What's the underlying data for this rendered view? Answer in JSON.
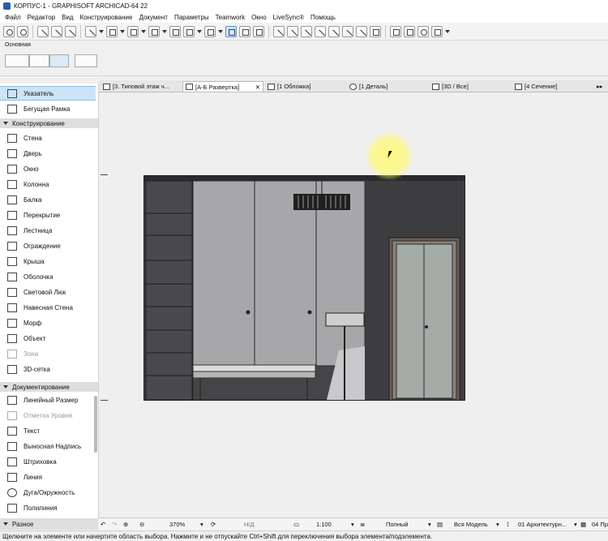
{
  "window": {
    "title": "КОРПУС-1 - GRAPHISOFT ARCHICAD-64 22"
  },
  "menu": [
    "Файл",
    "Редактор",
    "Вид",
    "Конструирование",
    "Документ",
    "Параметры",
    "Teamwork",
    "Окно",
    "LiveSync®",
    "Помощь"
  ],
  "infobox": {
    "label": "Основная"
  },
  "toolbox": {
    "pointer": "Указатель",
    "marquee": "Бегущая Рамка",
    "cat_design": "Конструирование",
    "design": [
      "Стена",
      "Дверь",
      "Окно",
      "Колонна",
      "Балка",
      "Перекрытие",
      "Лестница",
      "Ограждение",
      "Крыша",
      "Оболочка",
      "Световой Люк",
      "Навесная Стена",
      "Морф",
      "Объект",
      "Зона",
      "3D-сетка"
    ],
    "cat_doc": "Документирование",
    "doc": [
      "Линейный Размер",
      "Отметка Уровня",
      "Текст",
      "Выносная Надпись",
      "Штриховка",
      "Линия",
      "Дуга/Окружность",
      "Полилиния"
    ],
    "cat_misc": "Разное"
  },
  "tabs": [
    "[3. Типовой этаж ч...",
    "[А-Б Развертка]",
    "[1 Обложка]",
    "[1 Деталь]",
    "[3D / Все]",
    "[4 Сечение]"
  ],
  "nav": {
    "zoom": "370%",
    "angle": "Н/Д",
    "scale": "1:100",
    "model": "Полный",
    "filter": "Вся Модель",
    "layer": "01 Архитектурн...",
    "extra": "04 Пр"
  },
  "status": "Щелкните на элементе или начертите область выбора. Нажмите и не отпускайте Ctrl+Shift для переключения выбора элемента/подэлемента."
}
